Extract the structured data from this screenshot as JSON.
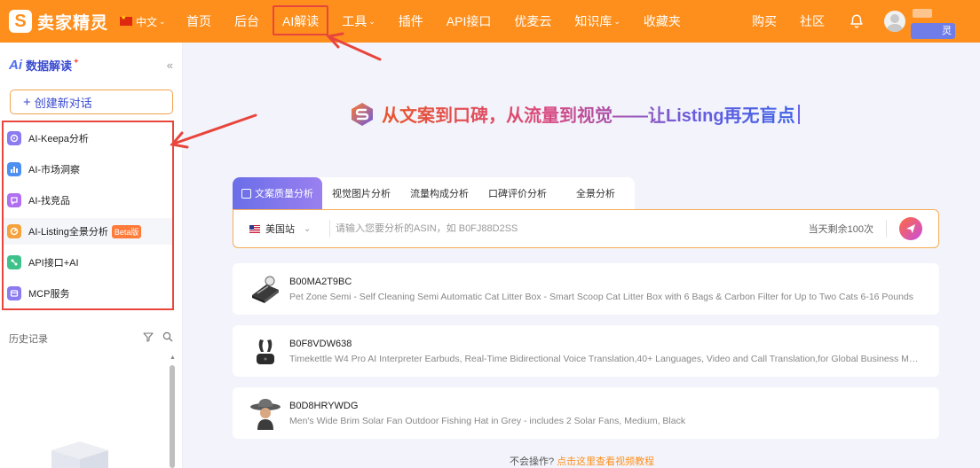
{
  "brand": {
    "logo_glyph": "S",
    "name": "卖家精灵"
  },
  "language": {
    "label": "中文"
  },
  "nav": {
    "items": [
      {
        "label": "首页"
      },
      {
        "label": "后台"
      },
      {
        "label": "AI解读"
      },
      {
        "label": "工具"
      },
      {
        "label": "插件"
      },
      {
        "label": "API接口"
      },
      {
        "label": "优麦云"
      },
      {
        "label": "知识库"
      },
      {
        "label": "收藏夹"
      }
    ],
    "active_index": 2,
    "right": {
      "buy": "购买",
      "community": "社区",
      "user_tag": "灵"
    }
  },
  "sidebar": {
    "ai_mark": "Ai",
    "title": "数据解读",
    "sparkle": "✦",
    "collapse_icon": "«",
    "new_chat": {
      "plus": "+",
      "label": "创建新对话"
    },
    "menu": [
      {
        "label": "AI-Keepa分析",
        "icon": "keepa-icon",
        "color": "#8b7bf0"
      },
      {
        "label": "AI-市场洞察",
        "icon": "bar-chart-icon",
        "color": "#4e8ff2"
      },
      {
        "label": "AI-找竞品",
        "icon": "compare-icon",
        "color": "#b06ef0"
      },
      {
        "label": "AI-Listing全景分析",
        "icon": "listing-icon",
        "color": "#f5a23d",
        "badge": "Beta版"
      },
      {
        "label": "API接口+AI",
        "icon": "api-icon",
        "color": "#3ec28a"
      },
      {
        "label": "MCP服务",
        "icon": "mcp-icon",
        "color": "#8b7bf0"
      }
    ],
    "history_label": "历史记录",
    "scroll_up_glyph": "▲"
  },
  "main": {
    "hero": "从文案到口碑，从流量到视觉——让Listing再无盲点",
    "tabs": [
      {
        "label": "文案质量分析"
      },
      {
        "label": "视觉图片分析"
      },
      {
        "label": "流量构成分析"
      },
      {
        "label": "口碑评价分析"
      },
      {
        "label": "全景分析"
      }
    ],
    "search": {
      "site": "美国站",
      "chev": "⌄",
      "placeholder": "请输入您要分析的ASIN，如 B0FJ88D2SS",
      "remaining": "当天剩余100次"
    },
    "products": [
      {
        "asin": "B00MA2T9BC",
        "title": "Pet Zone Semi - Self Cleaning Semi Automatic Cat Litter Box - Smart Scoop Cat Litter Box with 6 Bags & Carbon Filter for Up to Two Cats 6-16 Pounds"
      },
      {
        "asin": "B0F8VDW638",
        "title": "Timekettle W4 Pro AI Interpreter Earbuds, Real-Time Bidirectional Voice Translation,40+ Languages, Video and Call Translation,for Global Business Meetings"
      },
      {
        "asin": "B0D8HRYWDG",
        "title": "Men's Wide Brim Solar Fan Outdoor Fishing Hat in Grey - includes 2 Solar Fans, Medium, Black"
      }
    ],
    "help": {
      "question": "不会操作?",
      "link": "点击这里查看视频教程"
    }
  },
  "colors": {
    "brand_orange": "#fe8f1c",
    "annotation_red": "#e8453c",
    "accent_purple": "#6a6ee8"
  }
}
